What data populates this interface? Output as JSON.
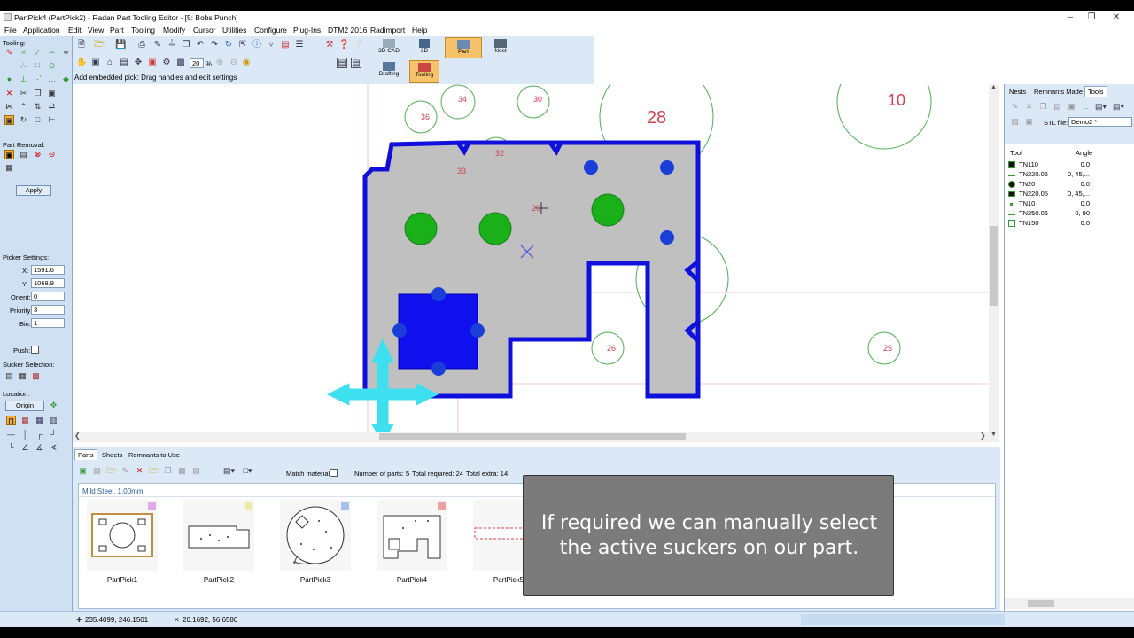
{
  "window": {
    "title": "PartPick4 (PartPick2) - Radan Part Tooling Editor - [5: Bobs Punch]",
    "controls": [
      "minimize",
      "restore",
      "close"
    ]
  },
  "menu": [
    "File",
    "Application",
    "Edit",
    "View",
    "Part",
    "Tooling",
    "Modify",
    "Cursor",
    "Utilities",
    "Configure",
    "Plug-Ins",
    "DTM2 2016",
    "Radimport",
    "Help"
  ],
  "left_panel": {
    "tooling_label": "Tooling:",
    "part_removal_label": "Part Removal:",
    "apply_label": "Apply",
    "picker_settings_label": "Picker Settings:",
    "fields": [
      {
        "label": "X:",
        "value": "1591.6"
      },
      {
        "label": "Y:",
        "value": "1068.9"
      },
      {
        "label": "Orient:",
        "value": "0"
      },
      {
        "label": "Priority:",
        "value": "3"
      },
      {
        "label": "Bin:",
        "value": "1"
      }
    ],
    "push_label": "Push:",
    "sucker_selection_label": "Sucker Selection:",
    "location_label": "Location:",
    "origin_label": "Origin"
  },
  "toolbar": {
    "zoom_value": "20",
    "zoom_unit": "%",
    "hint": "Add embedded pick: Drag handles and edit settings",
    "modes": [
      "2D CAD",
      "3D",
      "Part",
      "Nest",
      "Drafting",
      "Tooling"
    ]
  },
  "canvas": {
    "circle_labels": [
      "34",
      "30",
      "36",
      "28",
      "10",
      "32",
      "33",
      "29",
      "26",
      "25"
    ]
  },
  "bottom": {
    "tabs": [
      "Parts",
      "Sheets",
      "Remnants to Use"
    ],
    "match_material_label": "Match material:",
    "number_of_parts": "Number of parts: 5",
    "total_required": "Total required: 24",
    "total_extra": "Total extra: 14",
    "material": "Mild Steel, 1.00mm",
    "parts": [
      {
        "name": "PartPick1",
        "color": "#e2a8e8"
      },
      {
        "name": "PartPick2",
        "color": "#e6eea0"
      },
      {
        "name": "PartPick3",
        "color": "#a8c0ec"
      },
      {
        "name": "PartPick4",
        "color": "#f0a0a0"
      },
      {
        "name": "PartPick5",
        "color": ""
      }
    ]
  },
  "right_panel": {
    "tabs": [
      "Nests",
      "Remnants Made",
      "Tools"
    ],
    "stl_label": "STL file:",
    "stl_value": "Demo2 *",
    "col_tool": "Tool",
    "col_angle": "Angle",
    "tools": [
      {
        "name": "TN110",
        "angle": "0.0"
      },
      {
        "name": "TN220.06",
        "angle": "0, 45,..."
      },
      {
        "name": "TN20",
        "angle": "0.0"
      },
      {
        "name": "TN220.05",
        "angle": "0, 45,..."
      },
      {
        "name": "TN10",
        "angle": "0.0"
      },
      {
        "name": "TN250.06",
        "angle": "0, 90"
      },
      {
        "name": "TN150",
        "angle": "0.0"
      }
    ]
  },
  "status": {
    "coord1": "235.4099, 246.1501",
    "coord2": "20.1692, 56.6580"
  },
  "caption": {
    "line1": "If required we can manually select",
    "line2": "the active suckers on our part."
  }
}
